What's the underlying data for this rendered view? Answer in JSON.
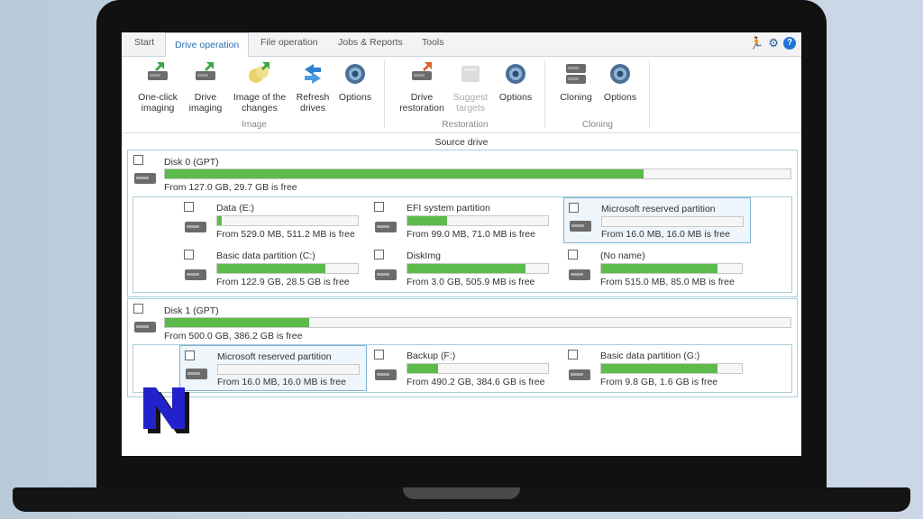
{
  "tabs": [
    {
      "label": "Start"
    },
    {
      "label": "Drive operation"
    },
    {
      "label": "File operation"
    },
    {
      "label": "Jobs & Reports"
    },
    {
      "label": "Tools"
    }
  ],
  "ribbon": {
    "image_group": {
      "label": "Image",
      "buttons": [
        {
          "line1": "One-click",
          "line2": "imaging"
        },
        {
          "line1": "Drive",
          "line2": "imaging"
        },
        {
          "line1": "Image of the",
          "line2": "changes"
        },
        {
          "line1": "Refresh",
          "line2": "drives"
        },
        {
          "line1": "Options",
          "line2": ""
        }
      ]
    },
    "restoration_group": {
      "label": "Restoration",
      "buttons": [
        {
          "line1": "Drive",
          "line2": "restoration"
        },
        {
          "line1": "Suggest",
          "line2": "targets"
        },
        {
          "line1": "Options",
          "line2": ""
        }
      ]
    },
    "cloning_group": {
      "label": "Cloning",
      "buttons": [
        {
          "line1": "Cloning",
          "line2": ""
        },
        {
          "line1": "Options",
          "line2": ""
        }
      ]
    }
  },
  "source_label": "Source drive",
  "disks": [
    {
      "name": "Disk 0 (GPT)",
      "info": "From 127.0 GB, 29.7 GB is free",
      "used_fraction": 0.765,
      "partitions": [
        {
          "name": "Data (E:)",
          "info": "From 529.0 MB, 511.2 MB is free",
          "used_fraction": 0.03
        },
        {
          "name": "EFI system partition",
          "info": "From 99.0 MB, 71.0 MB is free",
          "used_fraction": 0.28
        },
        {
          "name": "Microsoft reserved partition",
          "info": "From 16.0 MB, 16.0 MB is free",
          "used_fraction": 0.0
        },
        {
          "name": "Basic data partition (C:)",
          "info": "From 122.9 GB, 28.5 GB is free",
          "used_fraction": 0.77
        },
        {
          "name": "DiskImg",
          "info": "From 3.0 GB, 505.9 MB is free",
          "used_fraction": 0.84
        },
        {
          "name": "(No name)",
          "info": "From 515.0 MB, 85.0 MB is free",
          "used_fraction": 0.83
        }
      ]
    },
    {
      "name": "Disk 1 (GPT)",
      "info": "From 500.0 GB, 386.2 GB is free",
      "used_fraction": 0.23,
      "partitions": [
        {
          "name": "Microsoft reserved partition",
          "info": "From 16.0 MB, 16.0 MB is free",
          "used_fraction": 0.0
        },
        {
          "name": "Backup (F:)",
          "info": "From 490.2 GB, 384.6 GB is free",
          "used_fraction": 0.22
        },
        {
          "name": "Basic data partition (G:)",
          "info": "From 9.8 GB, 1.6 GB is free",
          "used_fraction": 0.83
        }
      ]
    }
  ],
  "colors": {
    "accent": "#2a6fb0",
    "bar_fill": "#5cbb4a",
    "border": "#a9cdd8"
  }
}
